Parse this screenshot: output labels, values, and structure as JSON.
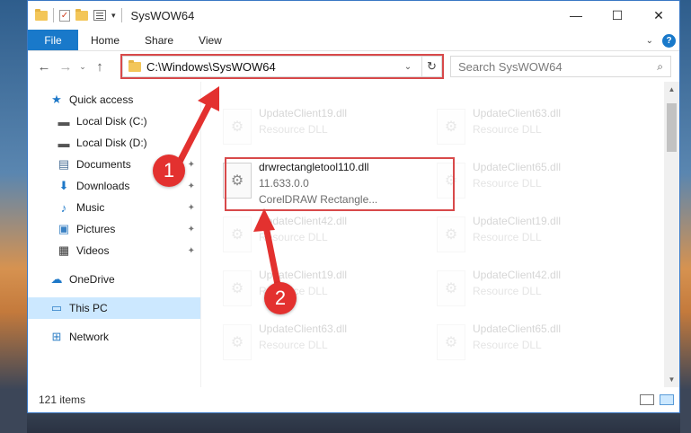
{
  "window": {
    "title": "SysWOW64",
    "controls": {
      "minimize": "—",
      "maximize": "☐",
      "close": "✕"
    }
  },
  "ribbon": {
    "tabs": [
      "File",
      "Home",
      "Share",
      "View"
    ],
    "help": "?"
  },
  "nav": {
    "back": "←",
    "forward": "→",
    "recent": "⌄",
    "up": "↑"
  },
  "address": {
    "path": "C:\\Windows\\SysWOW64",
    "refresh": "↻"
  },
  "search": {
    "placeholder": "Search SysWOW64"
  },
  "sidebar": {
    "items": [
      {
        "label": "Quick access",
        "icon": "star-icon"
      },
      {
        "label": "Local Disk (C:)",
        "icon": "drive-icon"
      },
      {
        "label": "Local Disk (D:)",
        "icon": "drive-icon"
      },
      {
        "label": "Documents",
        "icon": "documents-icon",
        "pinned": true
      },
      {
        "label": "Downloads",
        "icon": "download-icon",
        "pinned": true
      },
      {
        "label": "Music",
        "icon": "music-icon",
        "pinned": true
      },
      {
        "label": "Pictures",
        "icon": "pictures-icon",
        "pinned": true
      },
      {
        "label": "Videos",
        "icon": "videos-icon",
        "pinned": true
      },
      {
        "label": "OneDrive",
        "icon": "cloud-icon"
      },
      {
        "label": "This PC",
        "icon": "computer-icon",
        "selected": true
      },
      {
        "label": "Network",
        "icon": "network-icon"
      }
    ]
  },
  "files": {
    "left": [
      {
        "name": "UpdateClient19.dll",
        "sub": "Resource DLL",
        "faded": true
      },
      {
        "name": "drwrectangletool110.dll",
        "version": "11.633.0.0",
        "desc": "CorelDRAW Rectangle...",
        "faded": false
      },
      {
        "name": "UpdateClient42.dll",
        "sub": "Resource DLL",
        "faded": true
      },
      {
        "name": "UpdateClient19.dll",
        "sub": "Resource DLL",
        "faded": true
      },
      {
        "name": "UpdateClient63.dll",
        "sub": "Resource DLL",
        "faded": true
      }
    ],
    "right": [
      {
        "name": "UpdateClient63.dll",
        "sub": "Resource DLL"
      },
      {
        "name": "UpdateClient65.dll",
        "sub": "Resource DLL"
      },
      {
        "name": "UpdateClient19.dll",
        "sub": "Resource DLL"
      },
      {
        "name": "UpdateClient42.dll",
        "sub": "Resource DLL"
      },
      {
        "name": "UpdateClient65.dll",
        "sub": "Resource DLL"
      }
    ]
  },
  "status": {
    "count": "121 items"
  },
  "annotations": {
    "step1": "1",
    "step2": "2",
    "color": "#e3312f"
  }
}
